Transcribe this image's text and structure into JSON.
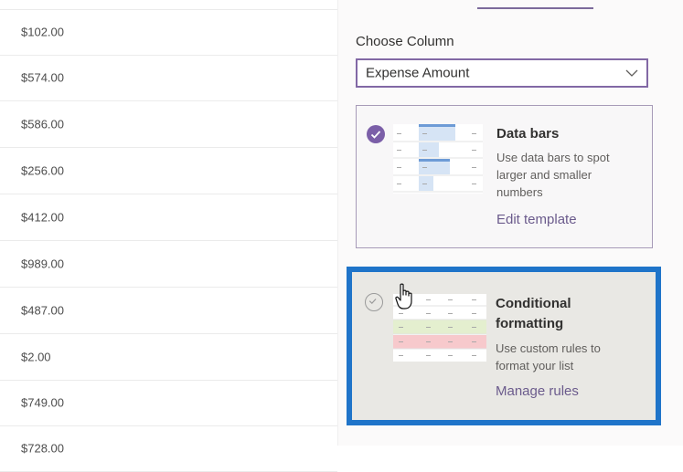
{
  "list": {
    "amounts": [
      "$102.00",
      "$574.00",
      "$586.00",
      "$256.00",
      "$412.00",
      "$989.00",
      "$487.00",
      "$2.00",
      "$749.00",
      "$728.00"
    ]
  },
  "panel": {
    "choose_column_label": "Choose Column",
    "select_value": "Expense Amount",
    "cards": [
      {
        "title": "Data bars",
        "desc_lines": [
          "Use data bars to spot",
          "larger and smaller",
          "numbers"
        ],
        "link": "Edit template",
        "selected": true
      },
      {
        "title_lines": [
          "Conditional",
          "formatting"
        ],
        "desc_lines": [
          "Use custom rules to",
          "format your list"
        ],
        "link": "Manage rules",
        "selected": false
      }
    ]
  },
  "colors": {
    "accent": "#7b5fa8",
    "highlight_frame": "#1f74c9",
    "link": "#6b5b8c"
  },
  "icons": [
    "checkmark-circle-icon",
    "chevron-down-icon",
    "hand-pointer-cursor-icon"
  ]
}
